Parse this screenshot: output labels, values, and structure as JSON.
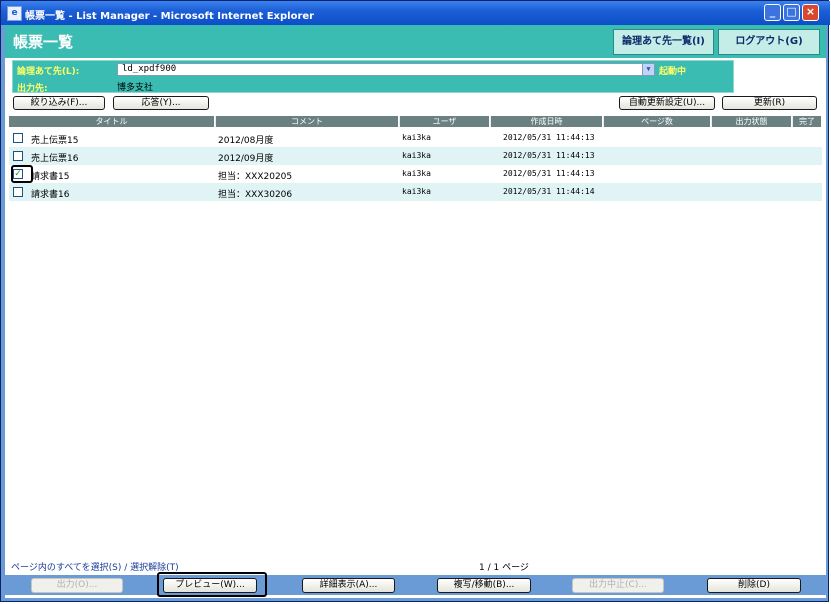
{
  "window": {
    "title": "帳票一覧 - List Manager - Microsoft Internet Explorer",
    "icon": "ie-icon"
  },
  "header": {
    "title": "帳票一覧",
    "logical_dest_list_label": "論理あて先一覧(I)",
    "logout_label": "ログアウト(G)"
  },
  "info": {
    "dest_label": "論理あて先(L):",
    "dest_value": "ld_xpdf900",
    "status": "起動中",
    "output_label": "出力先:",
    "output_value": "博多支社"
  },
  "toolbar": {
    "filter_label": "絞り込み(F)...",
    "reply_label": "応答(Y)...",
    "auto_update_label": "自動更新設定(U)...",
    "refresh_label": "更新(R)"
  },
  "table": {
    "headers": [
      "タイトル",
      "コメント",
      "ユーザ",
      "作成日時",
      "ページ数",
      "出力状態",
      "完了"
    ],
    "rows": [
      {
        "title": "売上伝票15",
        "comment": "2012/08月度",
        "user": "kai3ka",
        "date": "2012/05/31 11:44:13",
        "checked": false
      },
      {
        "title": "売上伝票16",
        "comment": "2012/09月度",
        "user": "kai3ka",
        "date": "2012/05/31 11:44:13",
        "checked": false
      },
      {
        "title": "請求書15",
        "comment": "担当：XXX20205",
        "user": "kai3ka",
        "date": "2012/05/31 11:44:13",
        "checked": true
      },
      {
        "title": "請求書16",
        "comment": "担当：XXX30206",
        "user": "kai3ka",
        "date": "2012/05/31 11:44:14",
        "checked": false
      }
    ]
  },
  "footer": {
    "select_all": "ページ内のすべてを選択(S)",
    "separator": " / ",
    "deselect": "選択解除(T)",
    "page_info": "1 / 1 ページ",
    "output_label": "出力(O)...",
    "preview_label": "プレビュー(W)...",
    "detail_label": "詳細表示(A)...",
    "copy_move_label": "複写/移動(B)...",
    "stop_output_label": "出力中止(C)...",
    "delete_label": "削除(D)"
  },
  "colors": {
    "header_teal": "#3bbcb3",
    "label_yellow": "#ffff66",
    "row_alt": "#e0f4f6",
    "table_header": "#6b8080"
  }
}
